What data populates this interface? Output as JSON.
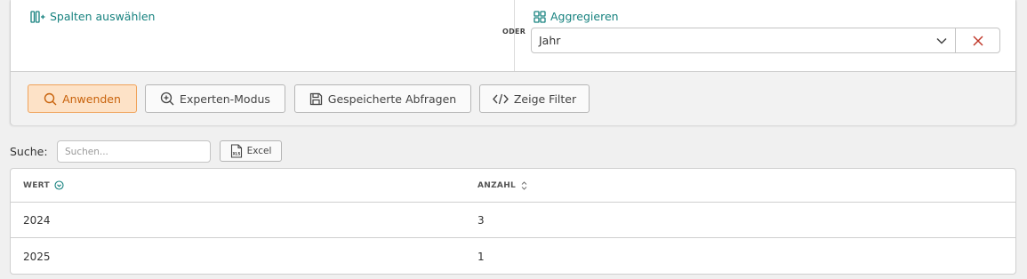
{
  "toolbar": {
    "select_columns": "Spalten auswählen",
    "aggregate": "Aggregieren",
    "or_label": "ODER",
    "aggregate_select_value": "Jahr"
  },
  "actions": {
    "apply": "Anwenden",
    "expert_mode": "Experten-Modus",
    "saved_queries": "Gespeicherte Abfragen",
    "show_filter": "Zeige Filter"
  },
  "search": {
    "label": "Suche:",
    "placeholder": "Suchen...",
    "value": "",
    "excel_label": "Excel",
    "excel_icon_text": "XLS"
  },
  "table": {
    "columns": [
      "WERT",
      "ANZAHL"
    ],
    "rows": [
      [
        "2024",
        "3"
      ],
      [
        "2025",
        "1"
      ]
    ]
  },
  "colors": {
    "accent_teal": "#17827f",
    "apply_bg": "#fde2c7",
    "apply_text": "#c8620b",
    "clear_red": "#c0392b"
  },
  "icons": {
    "select_columns": "columns-add-icon",
    "aggregate": "grid-icon",
    "chevron": "chevron-down-icon",
    "clear": "close-icon",
    "apply": "search-icon",
    "expert": "zoom-in-icon",
    "saved": "save-icon",
    "filter": "code-icon",
    "excel": "xls-file-icon",
    "sort_active": "sort-active-icon",
    "sort": "sort-icon"
  }
}
